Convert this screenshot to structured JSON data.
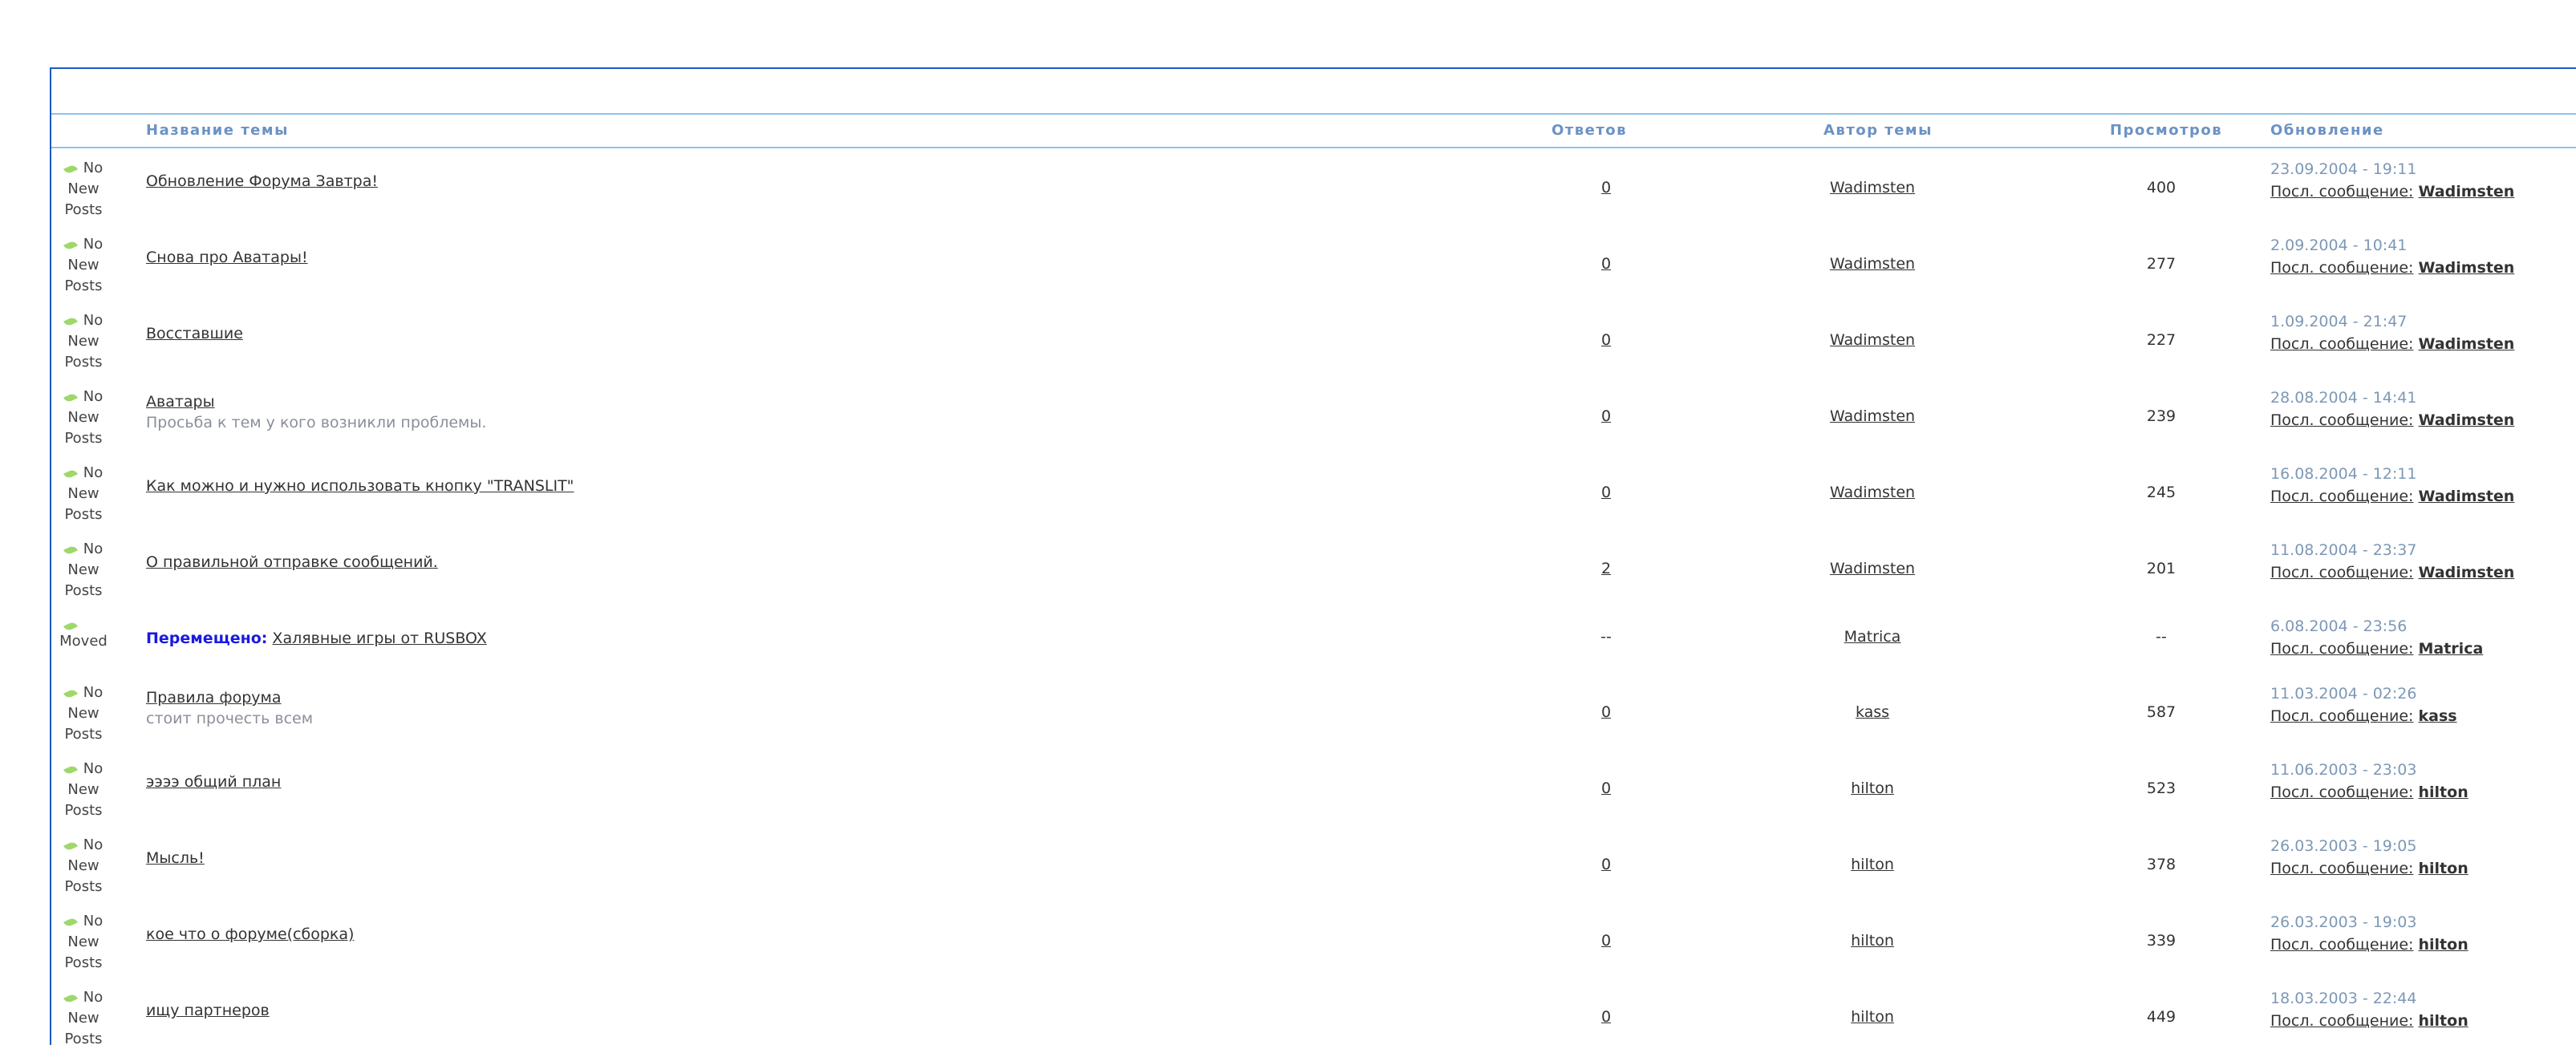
{
  "columns": {
    "topic": "Название темы",
    "replies": "Ответов",
    "author": "Автор темы",
    "views": "Просмотров",
    "updated": "Обновление"
  },
  "last_post_label": "Посл. сообщение:",
  "moved_label": "Перемещено:",
  "rows": [
    {
      "status": [
        "No",
        "New",
        "Posts"
      ],
      "title": "Обновление Форума Завтра!",
      "desc": "",
      "replies": "0",
      "author": "Wadimsten",
      "views": "400",
      "date": "23.09.2004 - 19:11",
      "last_author": "Wadimsten"
    },
    {
      "status": [
        "No",
        "New",
        "Posts"
      ],
      "title": "Снова про Аватары!",
      "desc": "",
      "replies": "0",
      "author": "Wadimsten",
      "views": "277",
      "date": "2.09.2004 - 10:41",
      "last_author": "Wadimsten"
    },
    {
      "status": [
        "No",
        "New",
        "Posts"
      ],
      "title": "Восставшие",
      "desc": "",
      "replies": "0",
      "author": "Wadimsten",
      "views": "227",
      "date": "1.09.2004 - 21:47",
      "last_author": "Wadimsten"
    },
    {
      "status": [
        "No",
        "New",
        "Posts"
      ],
      "title": "Аватары",
      "desc": "Просьба к тем у кого возникли проблемы.",
      "replies": "0",
      "author": "Wadimsten",
      "views": "239",
      "date": "28.08.2004 - 14:41",
      "last_author": "Wadimsten"
    },
    {
      "status": [
        "No",
        "New",
        "Posts"
      ],
      "title": "Как можно и нужно использовать кнопку \"TRANSLIT\"",
      "desc": "",
      "replies": "0",
      "author": "Wadimsten",
      "views": "245",
      "date": "16.08.2004 - 12:11",
      "last_author": "Wadimsten"
    },
    {
      "status": [
        "No",
        "New",
        "Posts"
      ],
      "title": "О правильной отправке сообщений.",
      "desc": "",
      "replies": "2",
      "author": "Wadimsten",
      "views": "201",
      "date": "11.08.2004 - 23:37",
      "last_author": "Wadimsten"
    },
    {
      "status": [
        "Moved"
      ],
      "moved": true,
      "title": "Халявные игры от RUSBOX",
      "desc": "",
      "replies": "--",
      "author": "Matrica",
      "views": "--",
      "date": "6.08.2004 - 23:56",
      "last_author": "Matrica"
    },
    {
      "status": [
        "No",
        "New",
        "Posts"
      ],
      "title": "Правила форума",
      "desc": "стоит прочесть всем",
      "replies": "0",
      "author": "kass",
      "views": "587",
      "date": "11.03.2004 - 02:26",
      "last_author": "kass"
    },
    {
      "status": [
        "No",
        "New",
        "Posts"
      ],
      "title": "ээээ общий план",
      "desc": "",
      "replies": "0",
      "author": "hilton",
      "views": "523",
      "date": "11.06.2003 - 23:03",
      "last_author": "hilton"
    },
    {
      "status": [
        "No",
        "New",
        "Posts"
      ],
      "title": "Мысль!",
      "desc": "",
      "replies": "0",
      "author": "hilton",
      "views": "378",
      "date": "26.03.2003 - 19:05",
      "last_author": "hilton"
    },
    {
      "status": [
        "No",
        "New",
        "Posts"
      ],
      "title": "кое что о форуме(сборка)",
      "desc": "",
      "replies": "0",
      "author": "hilton",
      "views": "339",
      "date": "26.03.2003 - 19:03",
      "last_author": "hilton"
    },
    {
      "status": [
        "No",
        "New",
        "Posts"
      ],
      "title": "ищу партнеров",
      "desc": "",
      "replies": "0",
      "author": "hilton",
      "views": "449",
      "date": "18.03.2003 - 22:44",
      "last_author": "hilton"
    }
  ]
}
